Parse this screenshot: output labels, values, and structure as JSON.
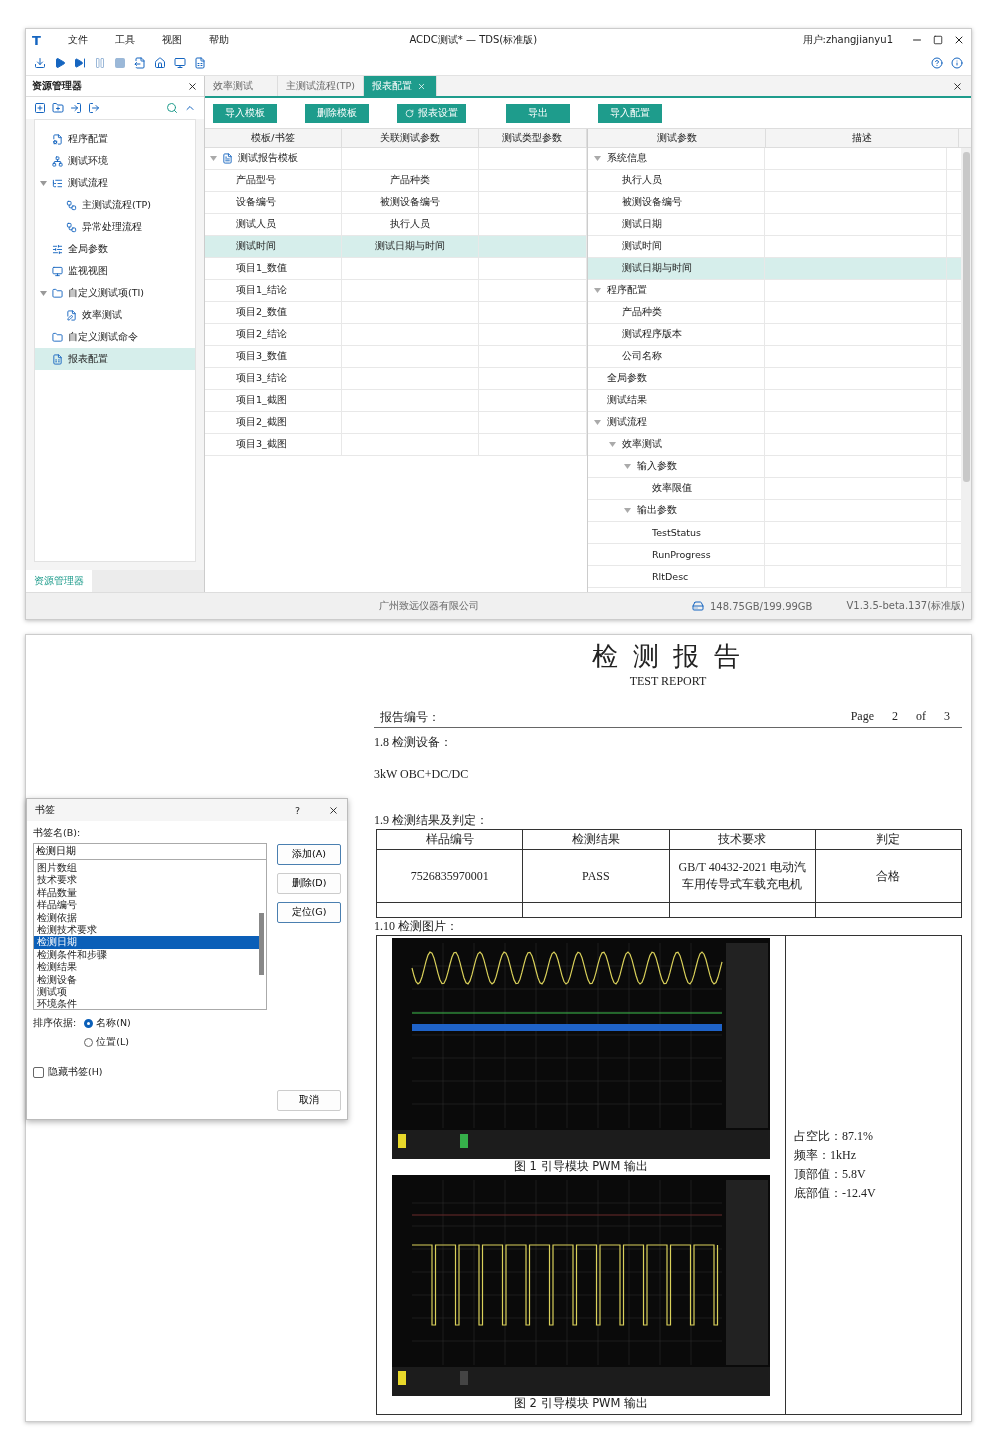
{
  "window": {
    "logo": "T",
    "menu": [
      "文件",
      "工具",
      "视图",
      "帮助"
    ],
    "title": "ACDC测试* — TDS(标准版)",
    "user": "用户:zhangjianyu1"
  },
  "sidebar": {
    "title": "资源管理器",
    "items": [
      {
        "label": "程序配置",
        "selected": false
      },
      {
        "label": "测试环境",
        "selected": false
      },
      {
        "label": "测试流程",
        "selected": false,
        "expanded": true,
        "children": [
          {
            "label": "主测试流程(TP)",
            "selected": false
          },
          {
            "label": "异常处理流程",
            "selected": false
          }
        ]
      },
      {
        "label": "全局参数",
        "selected": false
      },
      {
        "label": "监视视图",
        "selected": false
      },
      {
        "label": "自定义测试项(TI)",
        "selected": false,
        "expanded": true,
        "children": [
          {
            "label": "效率测试",
            "selected": false
          }
        ]
      },
      {
        "label": "自定义测试命令",
        "selected": false
      },
      {
        "label": "报表配置",
        "selected": true
      }
    ],
    "footer_tab": "资源管理器"
  },
  "tabs": [
    {
      "label": "效率测试",
      "selected": false
    },
    {
      "label": "主测试流程(TP)",
      "selected": false
    },
    {
      "label": "报表配置",
      "selected": true
    }
  ],
  "buttons": [
    {
      "label": "导入模板",
      "kind": "plain"
    },
    {
      "label": "删除模板",
      "kind": "plain"
    },
    {
      "label": "报表设置",
      "kind": "icon"
    },
    {
      "label": "导出",
      "kind": "plain"
    },
    {
      "label": "导入配置",
      "kind": "plain"
    }
  ],
  "template_table": {
    "columns": [
      "模板/书签",
      "关联测试参数",
      "测试类型参数"
    ],
    "tree": [
      {
        "label": "测试报告模板",
        "expanded": true,
        "children": [
          {
            "label": "产品型号",
            "param": "产品种类",
            "selected": false
          },
          {
            "label": "设备编号",
            "param": "被测设备编号",
            "selected": false
          },
          {
            "label": "测试人员",
            "param": "执行人员",
            "selected": false
          },
          {
            "label": "测试时间",
            "param": "测试日期与时间",
            "selected": true
          },
          {
            "label": "项目1_数值",
            "selected": false
          },
          {
            "label": "项目1_结论",
            "selected": false
          },
          {
            "label": "项目2_数值",
            "selected": false
          },
          {
            "label": "项目2_结论",
            "selected": false
          },
          {
            "label": "项目3_数值",
            "selected": false
          },
          {
            "label": "项目3_结论",
            "selected": false
          },
          {
            "label": "项目1_截图",
            "selected": false
          },
          {
            "label": "项目2_截图",
            "selected": false
          },
          {
            "label": "项目3_截图",
            "selected": false
          }
        ]
      }
    ]
  },
  "param_table": {
    "columns": [
      "测试参数",
      "描述"
    ],
    "tree": [
      {
        "label": "系统信息",
        "selected": false,
        "expanded": true,
        "children": [
          {
            "label": "执行人员",
            "selected": false
          },
          {
            "label": "被测设备编号",
            "selected": false
          },
          {
            "label": "测试日期",
            "selected": false
          },
          {
            "label": "测试时间",
            "selected": false
          },
          {
            "label": "测试日期与时间",
            "selected": true
          }
        ]
      },
      {
        "label": "程序配置",
        "selected": false,
        "expanded": true,
        "children": [
          {
            "label": "产品种类",
            "selected": false
          },
          {
            "label": "测试程序版本",
            "selected": false
          },
          {
            "label": "公司名称",
            "selected": false
          }
        ]
      },
      {
        "label": "全局参数",
        "selected": false
      },
      {
        "label": "测试结果",
        "selected": false
      },
      {
        "label": "测试流程",
        "selected": false,
        "expanded": true,
        "children": [
          {
            "label": "效率测试",
            "selected": false,
            "expanded": true,
            "children": [
              {
                "label": "输入参数",
                "selected": false,
                "expanded": true,
                "children": [
                  {
                    "label": "效率限值",
                    "selected": false
                  }
                ]
              },
              {
                "label": "输出参数",
                "selected": false,
                "expanded": true,
                "children": [
                  {
                    "label": "TestStatus",
                    "selected": false
                  },
                  {
                    "label": "RunProgress",
                    "selected": false
                  },
                  {
                    "label": "RltDesc",
                    "selected": false
                  }
                ]
              }
            ]
          }
        ]
      }
    ]
  },
  "status_bar": {
    "company": "广州致远仪器有限公司",
    "disk": "148.75GB/199.99GB",
    "version": "V1.3.5-beta.137(标准版)"
  },
  "dialog": {
    "title": "书签",
    "help": "?",
    "name_label": "书签名(B):",
    "name_value": "检测日期",
    "list": [
      {
        "label": "图片数组",
        "selected": false
      },
      {
        "label": "技术要求",
        "selected": false
      },
      {
        "label": "样品数量",
        "selected": false
      },
      {
        "label": "样品编号",
        "selected": false
      },
      {
        "label": "检测依据",
        "selected": false
      },
      {
        "label": "检测技术要求",
        "selected": false
      },
      {
        "label": "检测日期",
        "selected": true
      },
      {
        "label": "检测条件和步骤",
        "selected": false
      },
      {
        "label": "检测结果",
        "selected": false
      },
      {
        "label": "检测设备",
        "selected": false
      },
      {
        "label": "测试项",
        "selected": false
      },
      {
        "label": "环境条件",
        "selected": false
      }
    ],
    "side_buttons": [
      {
        "label": "添加(A)",
        "kind": "outlined"
      },
      {
        "label": "删除(D)",
        "kind": "plain"
      },
      {
        "label": "定位(G)",
        "kind": "outlined"
      }
    ],
    "sort_label": "排序依据:",
    "sort_options": [
      {
        "label": "名称(N)",
        "selected": true
      },
      {
        "label": "位置(L)",
        "selected": false
      }
    ],
    "hide_checkbox": {
      "label": "隐藏书签(H)",
      "checked": false
    },
    "cancel": "取消"
  },
  "report": {
    "title": "检 测 报 告",
    "subtitle": "TEST REPORT",
    "number_label": "报告编号：",
    "page": [
      "Page",
      "2",
      "of",
      "3"
    ],
    "section_equipment": "1.8  检测设备：",
    "equipment": "3kW OBC+DC/DC",
    "section_results": "1.9  检测结果及判定：",
    "results_columns": [
      "样品编号",
      "检测结果",
      "技术要求",
      "判定"
    ],
    "results_row": [
      "7526835970001",
      "PASS",
      "GB/T 40432-2021 电动汽车用传导式车载充电机",
      "合格"
    ],
    "section_images": "1.10  检测图片：",
    "figures": [
      {
        "caption": "图 1 引导模块 PWM 输出",
        "kind": "picture"
      },
      {
        "caption": "图 2 引导模块 PWM 输出",
        "kind": "picture"
      }
    ],
    "measurements": [
      "占空比：87.1%",
      "频率：1kHz",
      "顶部值：5.8V",
      "底部值：-12.4V"
    ]
  }
}
